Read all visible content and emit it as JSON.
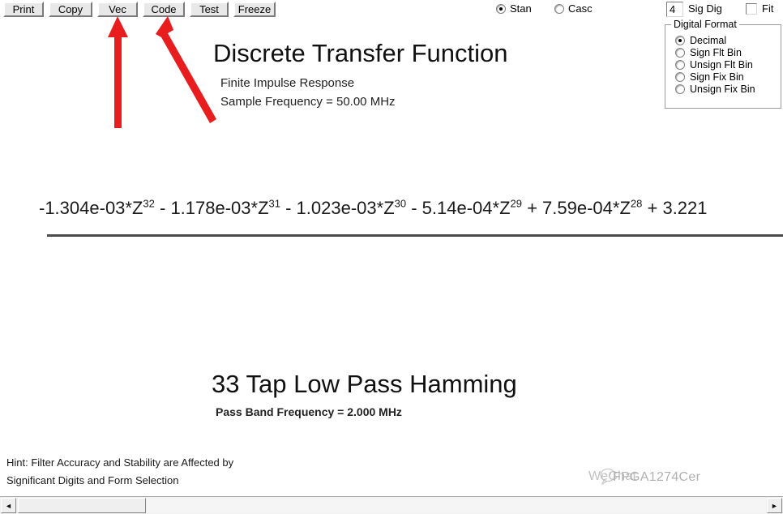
{
  "toolbar": {
    "buttons": [
      {
        "label": "Print",
        "name": "print-button"
      },
      {
        "label": "Copy",
        "name": "copy-button"
      },
      {
        "label": "Vec",
        "name": "vec-button"
      },
      {
        "label": "Code",
        "name": "code-button"
      },
      {
        "label": "Test",
        "name": "test-button"
      },
      {
        "label": "Freeze",
        "name": "freeze-button"
      }
    ]
  },
  "header_controls": {
    "form_radios": [
      {
        "label": "Stan",
        "selected": true
      },
      {
        "label": "Casc",
        "selected": false
      }
    ],
    "sig_dig_value": "4",
    "sig_dig_label": "Sig Dig",
    "fit_label": "Fit",
    "fit_checked": false
  },
  "digital_format": {
    "title": "Digital Format",
    "options": [
      {
        "label": "Decimal",
        "selected": true
      },
      {
        "label": "Sign Flt Bin",
        "selected": false
      },
      {
        "label": "Unsign Flt Bin",
        "selected": false
      },
      {
        "label": "Sign Fix Bin",
        "selected": false
      },
      {
        "label": "Unsign Fix Bin",
        "selected": false
      }
    ]
  },
  "title_block": {
    "heading": "Discrete Transfer Function",
    "subtitle_1": "Finite Impulse Response",
    "subtitle_2": "Sample Frequency = 50.00 MHz"
  },
  "equation": {
    "numerator_html": "-1.304e-03*Z<sup>32</sup> - 1.178e-03*Z<sup>31</sup> - 1.023e-03*Z<sup>30</sup> - 5.14e-04*Z<sup>29</sup> + 7.59e-04*Z<sup>28</sup> + 3.221",
    "terms": [
      {
        "sign": "-",
        "coefficient": "1.304e-03",
        "variable": "Z",
        "exponent": "32"
      },
      {
        "sign": "-",
        "coefficient": "1.178e-03",
        "variable": "Z",
        "exponent": "31"
      },
      {
        "sign": "-",
        "coefficient": "1.023e-03",
        "variable": "Z",
        "exponent": "30"
      },
      {
        "sign": "-",
        "coefficient": "5.14e-04",
        "variable": "Z",
        "exponent": "29"
      },
      {
        "sign": "+",
        "coefficient": "7.59e-04",
        "variable": "Z",
        "exponent": "28"
      },
      {
        "sign": "+",
        "coefficient": "3.221",
        "variable": "",
        "exponent": ""
      }
    ]
  },
  "filter_block": {
    "heading": "33 Tap Low Pass Hamming",
    "subtitle": "Pass Band Frequency = 2.000 MHz"
  },
  "hint": {
    "line_1": "Hint: Filter Accuracy and Stability are Affected by",
    "line_2": "Significant Digits and Form Selection"
  },
  "watermark": {
    "text_a": "WeChat",
    "text_b": "FPGA1274Cer"
  },
  "scrollbar": {
    "left_arrow": "◄",
    "right_arrow": "►"
  },
  "colors": {
    "annotation_red": "#e81e1e",
    "button_face": "#e8e8e8",
    "text": "#111111"
  }
}
